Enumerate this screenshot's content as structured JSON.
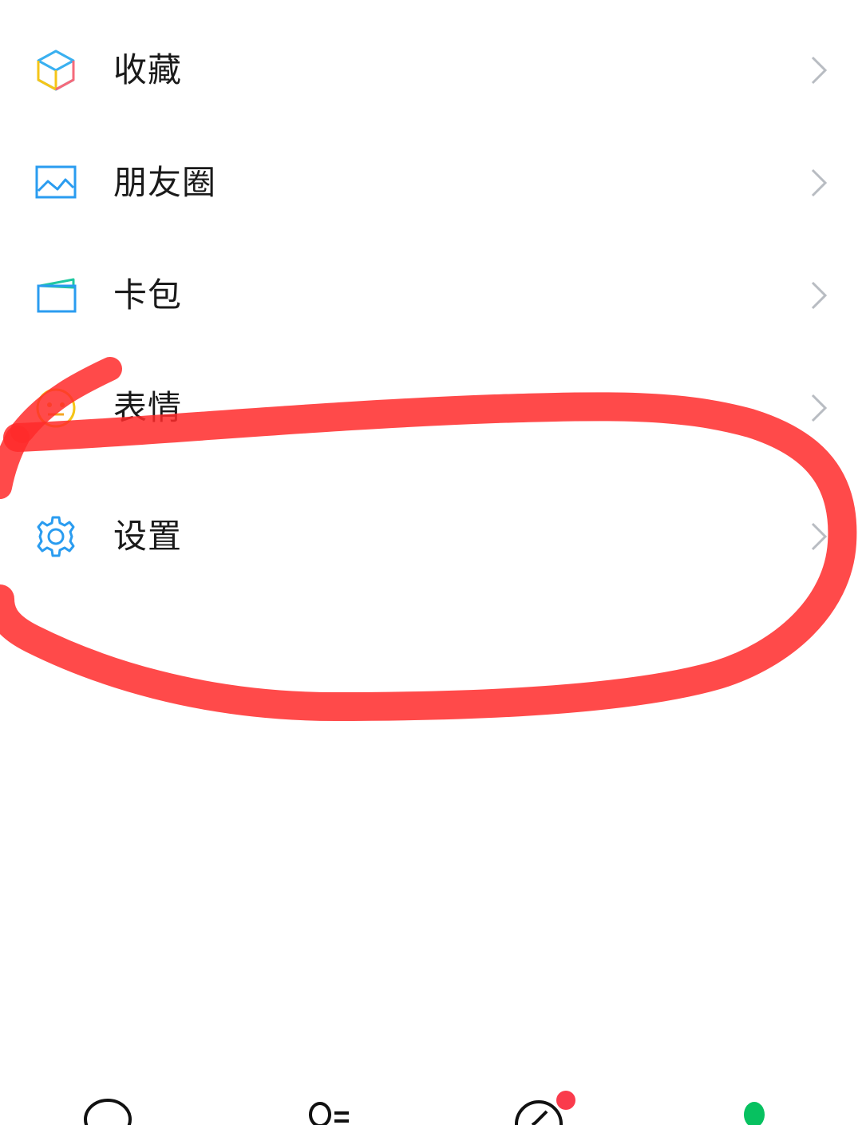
{
  "menu": {
    "items": [
      {
        "label": "收藏",
        "icon": "favorites-cube-icon"
      },
      {
        "label": "朋友圈",
        "icon": "moments-photo-icon"
      },
      {
        "label": "卡包",
        "icon": "card-wallet-icon"
      },
      {
        "label": "表情",
        "icon": "sticker-face-icon"
      },
      {
        "label": "设置",
        "icon": "settings-gear-icon"
      }
    ]
  },
  "annotation": {
    "color": "#ff2a2a",
    "shape": "hand-drawn ellipse around 设置"
  },
  "tabbar": {
    "tabs": [
      {
        "icon": "chat-bubble-icon"
      },
      {
        "icon": "contacts-icon"
      },
      {
        "icon": "discover-compass-icon",
        "badge": "red dot"
      },
      {
        "icon": "me-icon",
        "active": true
      }
    ],
    "colors": {
      "inactive": "#111111",
      "active": "#07c160",
      "badge": "#fa3b4c"
    }
  }
}
